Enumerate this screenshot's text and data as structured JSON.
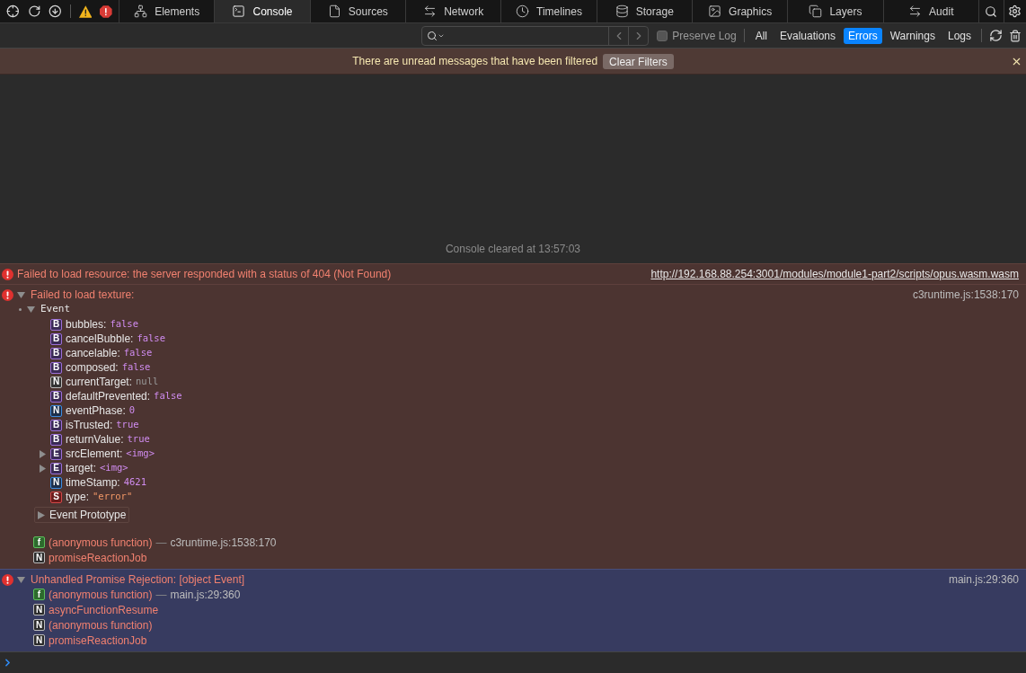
{
  "tabs": [
    {
      "label": "Elements",
      "selected": false
    },
    {
      "label": "Console",
      "selected": true
    },
    {
      "label": "Sources",
      "selected": false
    },
    {
      "label": "Network",
      "selected": false
    },
    {
      "label": "Timelines",
      "selected": false
    },
    {
      "label": "Storage",
      "selected": false
    },
    {
      "label": "Graphics",
      "selected": false
    },
    {
      "label": "Layers",
      "selected": false
    },
    {
      "label": "Audit",
      "selected": false
    }
  ],
  "filter_bar": {
    "preserve_log": {
      "label": "Preserve Log",
      "checked": false
    },
    "filters": [
      {
        "label": "All",
        "selected": false
      },
      {
        "label": "Evaluations",
        "selected": false
      },
      {
        "label": "Errors",
        "selected": true
      },
      {
        "label": "Warnings",
        "selected": false
      },
      {
        "label": "Logs",
        "selected": false
      }
    ]
  },
  "banner": {
    "text": "There are unread messages that have been filtered",
    "button": "Clear Filters"
  },
  "cleared_note": "Console cleared at 13:57:03",
  "messages": [
    {
      "selected": false,
      "text": "Failed to load resource: the server responded with a status of 404 (Not Found)",
      "source": {
        "text": "http://192.168.88.254:3001/modules/module1-part2/scripts/opus.wasm.wasm",
        "kind": "link"
      }
    },
    {
      "selected": false,
      "expanded": true,
      "text": "Failed to load texture:",
      "source": {
        "text": "c3runtime.js:1538:170",
        "kind": "location"
      },
      "object": {
        "label": "Event",
        "expanded": true,
        "properties": [
          {
            "badge": "B",
            "kind": "boolean",
            "name": "bubbles:",
            "value": "false",
            "expandable": false
          },
          {
            "badge": "B",
            "kind": "boolean",
            "name": "cancelBubble:",
            "value": "false",
            "expandable": false
          },
          {
            "badge": "B",
            "kind": "boolean",
            "name": "cancelable:",
            "value": "false",
            "expandable": false
          },
          {
            "badge": "B",
            "kind": "boolean",
            "name": "composed:",
            "value": "false",
            "expandable": false
          },
          {
            "badge": "N",
            "kind": "null",
            "name": "currentTarget:",
            "value": "null",
            "expandable": false
          },
          {
            "badge": "B",
            "kind": "boolean",
            "name": "defaultPrevented:",
            "value": "false",
            "expandable": false
          },
          {
            "badge": "N",
            "kind": "number",
            "name": "eventPhase:",
            "value": "0",
            "expandable": false
          },
          {
            "badge": "B",
            "kind": "boolean",
            "name": "isTrusted:",
            "value": "true",
            "expandable": false
          },
          {
            "badge": "B",
            "kind": "boolean",
            "name": "returnValue:",
            "value": "true",
            "expandable": false
          },
          {
            "badge": "E",
            "kind": "element",
            "name": "srcElement:",
            "value": "<img>",
            "expandable": true
          },
          {
            "badge": "E",
            "kind": "element",
            "name": "target:",
            "value": "<img>",
            "expandable": true
          },
          {
            "badge": "N",
            "kind": "number",
            "name": "timeStamp:",
            "value": "4621",
            "expandable": false
          },
          {
            "badge": "S",
            "kind": "string",
            "name": "type:",
            "value": "\"error\"",
            "expandable": false
          }
        ],
        "prototype": "Event Prototype"
      },
      "stack": [
        {
          "badge": "f",
          "kind": "function",
          "name": "(anonymous function)",
          "separator": "—",
          "location": "c3runtime.js:1538:170"
        },
        {
          "badge": "N",
          "kind": "native",
          "name": "promiseReactionJob"
        }
      ]
    },
    {
      "selected": true,
      "expanded": true,
      "text": "Unhandled Promise Rejection: [object Event]",
      "source": {
        "text": "main.js:29:360",
        "kind": "location"
      },
      "stack": [
        {
          "badge": "f",
          "kind": "function",
          "name": "(anonymous function)",
          "separator": "—",
          "location": "main.js:29:360"
        },
        {
          "badge": "N",
          "kind": "native",
          "name": "asyncFunctionResume"
        },
        {
          "badge": "N",
          "kind": "native",
          "name": "(anonymous function)"
        },
        {
          "badge": "N",
          "kind": "native",
          "name": "promiseReactionJob"
        }
      ]
    }
  ]
}
